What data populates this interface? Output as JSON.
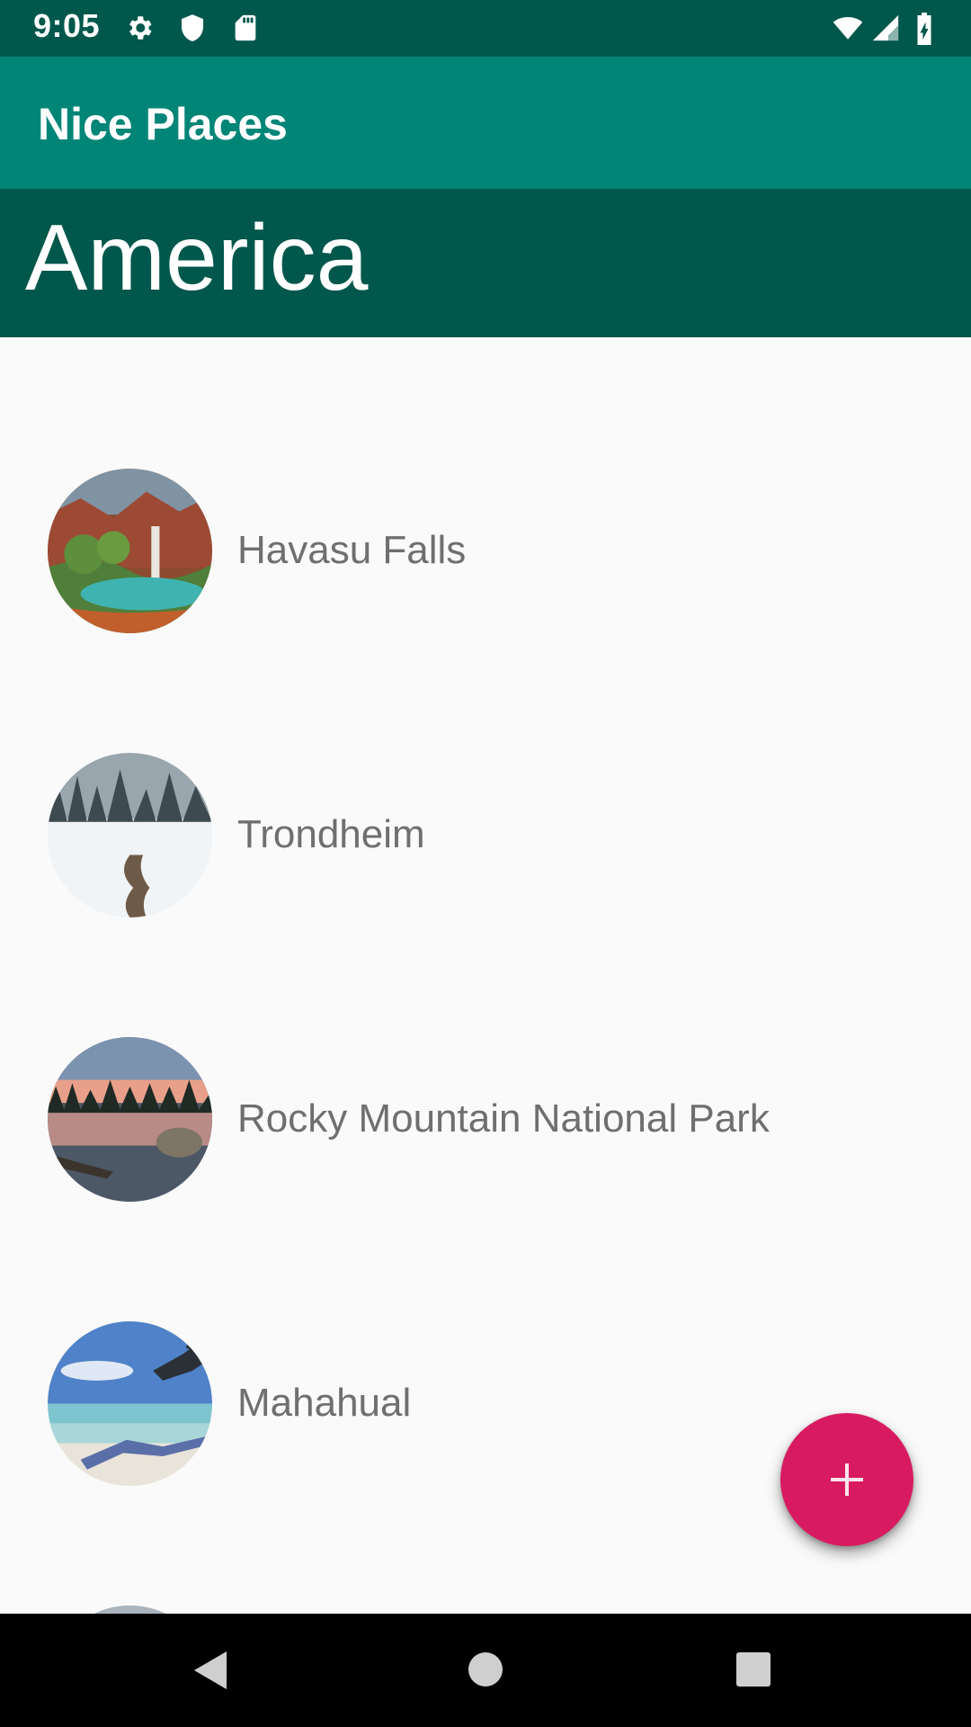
{
  "status_bar": {
    "time": "9:05",
    "left_icons": [
      "gear-icon",
      "shield-icon",
      "sd-card-icon"
    ],
    "right_icons": [
      "wifi-icon",
      "signal-icon",
      "battery-charging-icon"
    ]
  },
  "app_bar": {
    "title": "Nice Places"
  },
  "section": {
    "title": "America"
  },
  "places": [
    {
      "name": "Havasu Falls"
    },
    {
      "name": "Trondheim"
    },
    {
      "name": "Rocky Mountain National Park"
    },
    {
      "name": "Mahahual"
    }
  ],
  "fab": {
    "icon": "plus-icon",
    "color": "#d81b60"
  },
  "nav_bar": {
    "icons": [
      "back-icon",
      "home-icon",
      "recents-icon"
    ]
  },
  "colors": {
    "primary": "#008577",
    "primary_dark": "#00574b",
    "accent": "#d81b60"
  }
}
